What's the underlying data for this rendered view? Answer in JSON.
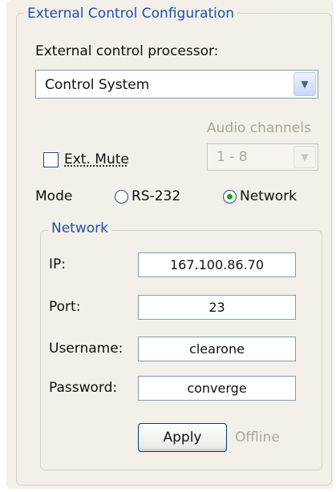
{
  "group": {
    "title": "External Control Configuration"
  },
  "processor": {
    "label": "External control processor:",
    "value": "Control System"
  },
  "audio_channels": {
    "label": "Audio channels",
    "value": "1 - 8",
    "enabled": false
  },
  "ext_mute": {
    "label": "Ext. Mute",
    "checked": false
  },
  "mode": {
    "label": "Mode",
    "options": [
      "RS-232",
      "Network"
    ],
    "selected": "Network"
  },
  "network": {
    "title": "Network",
    "ip": {
      "label": "IP:",
      "value": "167.100.86.70"
    },
    "port": {
      "label": "Port:",
      "value": "23"
    },
    "username": {
      "label": "Username:",
      "value": "clearone"
    },
    "password": {
      "label": "Password:",
      "value": "converge"
    }
  },
  "apply": {
    "label": "Apply"
  },
  "status": {
    "text": "Offline"
  },
  "colors": {
    "title_blue": "#1f4fb4",
    "radio_green": "#21a121",
    "disabled_gray": "#aca899"
  },
  "icons": {
    "dropdown": "chevron-down-icon"
  }
}
